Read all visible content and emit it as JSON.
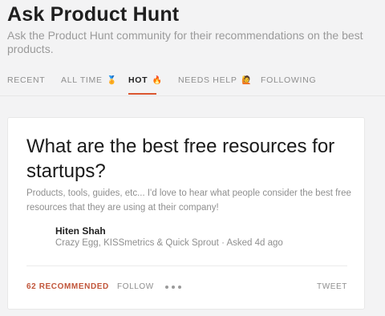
{
  "header": {
    "title": "Ask Product Hunt",
    "subtitle": "Ask the Product Hunt community for their recommendations on the best products."
  },
  "tabs": [
    {
      "label": "RECENT",
      "emoji": ""
    },
    {
      "label": "ALL TIME",
      "emoji": "🏅"
    },
    {
      "label": "HOT",
      "emoji": "🔥",
      "active": true
    },
    {
      "label": "NEEDS HELP",
      "emoji": "🙋"
    },
    {
      "label": "FOLLOWING",
      "emoji": ""
    }
  ],
  "post": {
    "question": "What are the best free resources for startups?",
    "excerpt": "Products, tools, guides, etc... I'd love to hear what people consider the best free resources that they are using at their company!",
    "author": {
      "name": "Hiten Shah",
      "meta": "Crazy Egg, KISSmetrics & Quick Sprout · Asked 4d ago"
    },
    "actions": {
      "recommend": "62 RECOMMENDED",
      "follow": "FOLLOW",
      "more": "more-icon",
      "tweet": "TWEET"
    }
  },
  "colors": {
    "accent": "#da552f",
    "recommend": "#c1553a"
  }
}
